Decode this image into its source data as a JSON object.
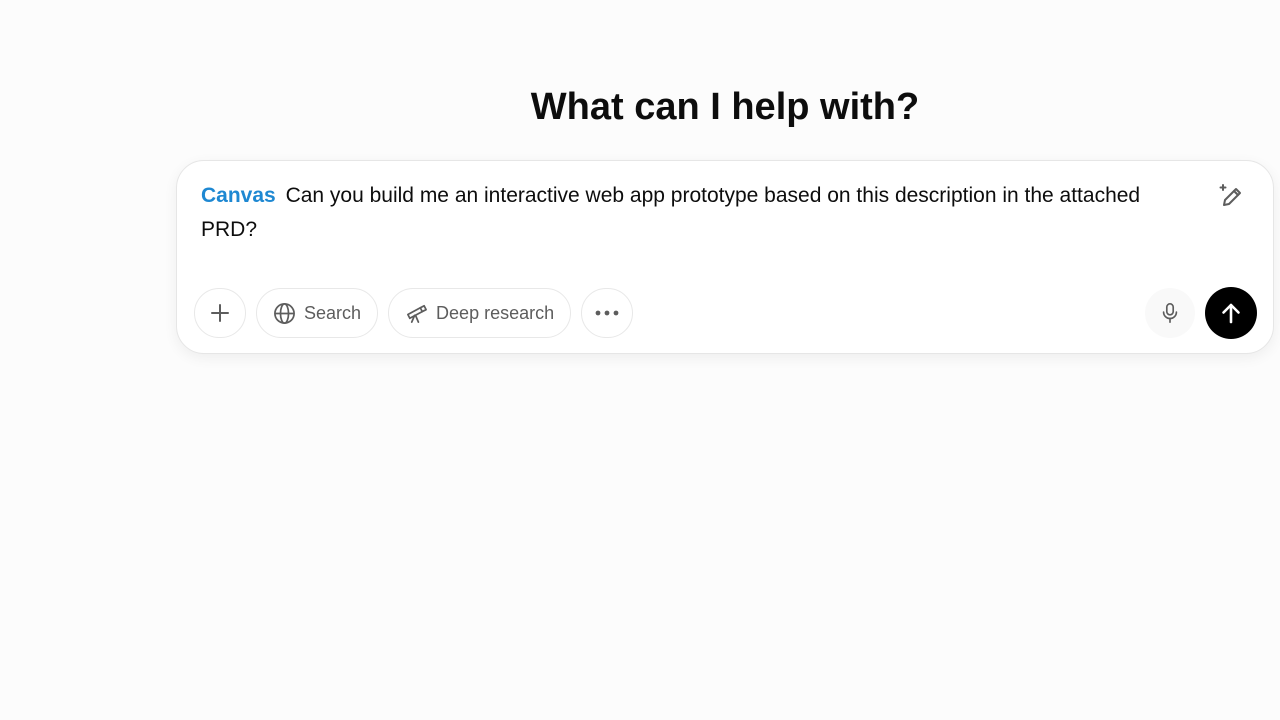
{
  "heading": "What can I help with?",
  "composer": {
    "tag": "Canvas",
    "prompt": "Can you build me an interactive web app prototype based on this description in the attached PRD?"
  },
  "toolbar": {
    "search_label": "Search",
    "deep_research_label": "Deep research"
  },
  "colors": {
    "canvas_tag": "#1e88d2",
    "send_button": "#000000",
    "background": "#fcfcfc"
  },
  "icons": {
    "add": "plus-icon",
    "search": "globe-icon",
    "deep_research": "telescope-icon",
    "more": "ellipsis-icon",
    "edit": "sparkle-pencil-icon",
    "mic": "microphone-icon",
    "send": "arrow-up-icon"
  }
}
